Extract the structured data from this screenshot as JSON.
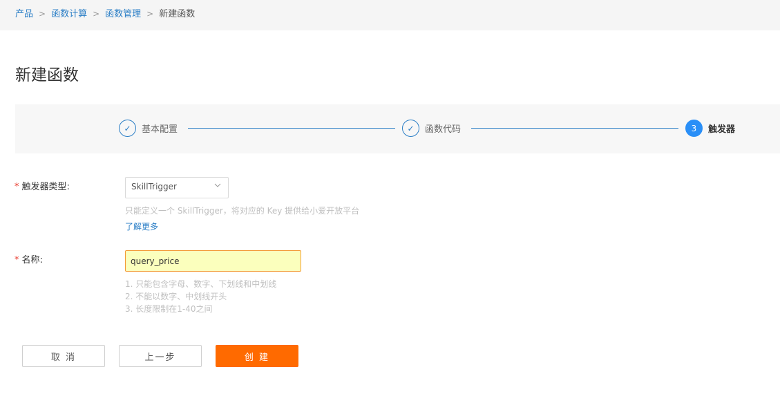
{
  "breadcrumb": {
    "items": [
      "产品",
      "函数计算",
      "函数管理"
    ],
    "current": "新建函数",
    "separator": ">"
  },
  "page_title": "新建函数",
  "steps": [
    {
      "marker": "✓",
      "label": "基本配置",
      "state": "done"
    },
    {
      "marker": "✓",
      "label": "函数代码",
      "state": "done"
    },
    {
      "marker": "3",
      "label": "触发器",
      "state": "active"
    }
  ],
  "form": {
    "required_mark": "*",
    "trigger_type": {
      "label": "触发器类型:",
      "value": "SkillTrigger",
      "help": "只能定义一个 SkillTrigger，将对应的 Key 提供给小爱开放平台",
      "learn_more": "了解更多"
    },
    "name": {
      "label": "名称:",
      "value": "query_price",
      "rules": [
        "1. 只能包含字母、数字、下划线和中划线",
        "2. 不能以数字、中划线开头",
        "3. 长度限制在1-40之间"
      ]
    }
  },
  "buttons": {
    "cancel": "取 消",
    "prev": "上一步",
    "create": "创 建"
  },
  "colors": {
    "link": "#2a7ec6",
    "primary": "#ff6a00",
    "step_active": "#2a8ff7",
    "required": "#e83a2e"
  }
}
